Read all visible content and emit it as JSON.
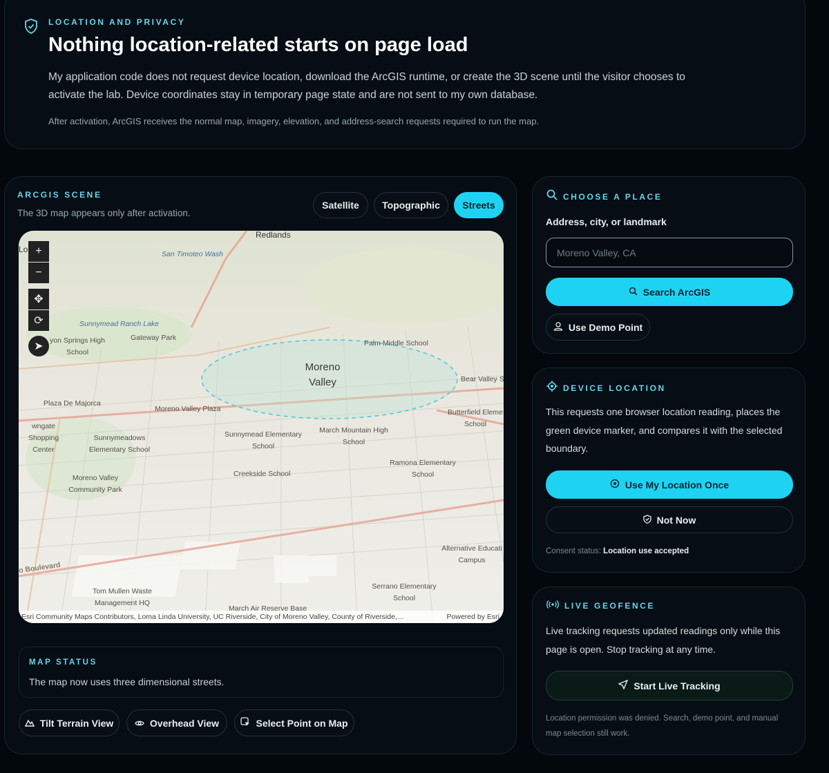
{
  "privacy": {
    "eyebrow": "LOCATION AND PRIVACY",
    "title": "Nothing location-related starts on page load",
    "body": "My application code does not request device location, download the ArcGIS runtime, or create the 3D scene until the visitor chooses to activate the lab. Device coordinates stay in temporary page state and are not sent to my own database.",
    "note": "After activation, ArcGIS receives the normal map, imagery, elevation, and address-search requests required to run the map."
  },
  "scene": {
    "eyebrow": "ARCGIS SCENE",
    "subtitle": "The 3D map appears only after activation.",
    "basemaps": [
      {
        "label": "Satellite",
        "active": false
      },
      {
        "label": "Topographic",
        "active": false
      },
      {
        "label": "Streets",
        "active": true
      }
    ],
    "map_labels": {
      "redlands": "Redlands",
      "san_timoteo": "San Timoteo Wash",
      "lo_ida": "Lon  ida",
      "sunnymead_lake": "Sunnymead Ranch Lake",
      "gateway_park": "Gateway Park",
      "canyon_springs": "yon Springs High School",
      "palm_middle": "Palm Middle School",
      "moreno_valley": "Moreno Valley",
      "bear_valley": "Bear Valley S",
      "plaza_majorca": "Plaza De Majorca",
      "mv_plaza": "Moreno Valley Plaza",
      "butterfield": "Butterfield Eleme School",
      "towngate": "wngate Shopping Center",
      "sunnymeadows": "Sunnymeadows Elementary School",
      "sunnymead_elem": "Sunnymead Elementary School",
      "march_mountain": "March Mountain High School",
      "ramona": "Ramona Elementary School",
      "mv_park": "Moreno Valley Community Park",
      "creekside": "Creekside School",
      "boulevard": "o Boulevard",
      "alt_edu": "Alternative Educati Campus",
      "serrano": "Serrano Elementary School",
      "tom_mullen": "Tom Mullen Waste Management HQ",
      "march_air": "March Air Reserve Base"
    },
    "attribution": "Esri Community Maps Contributors, Loma Linda University, UC Riverside, City of Moreno Valley, County of Riverside,...",
    "powered": "Powered by Esri",
    "status_eyebrow": "MAP STATUS",
    "status_text": "The map now uses three dimensional streets.",
    "actions": {
      "tilt": "Tilt Terrain View",
      "overhead": "Overhead View",
      "select": "Select Point on Map"
    }
  },
  "place": {
    "eyebrow": "CHOOSE A PLACE",
    "field_label": "Address, city, or landmark",
    "placeholder": "Moreno Valley, CA",
    "search_label": "Search ArcGIS",
    "demo_label": "Use Demo Point"
  },
  "device": {
    "eyebrow": "DEVICE LOCATION",
    "body": "This requests one browser location reading, places the green device marker, and compares it with the selected boundary.",
    "use_label": "Use My Location Once",
    "not_now_label": "Not Now",
    "consent_prefix": "Consent status:",
    "consent_value": "Location use accepted"
  },
  "geofence": {
    "eyebrow": "LIVE GEOFENCE",
    "body": "Live tracking requests updated readings only while this page is open. Stop tracking at any time.",
    "start_label": "Start Live Tracking",
    "note": "Location permission was denied. Search, demo point, and manual map selection still work."
  },
  "colors": {
    "accent": "#1ed3f2",
    "eyebrow": "#62d7ee",
    "background": "#03080d"
  }
}
